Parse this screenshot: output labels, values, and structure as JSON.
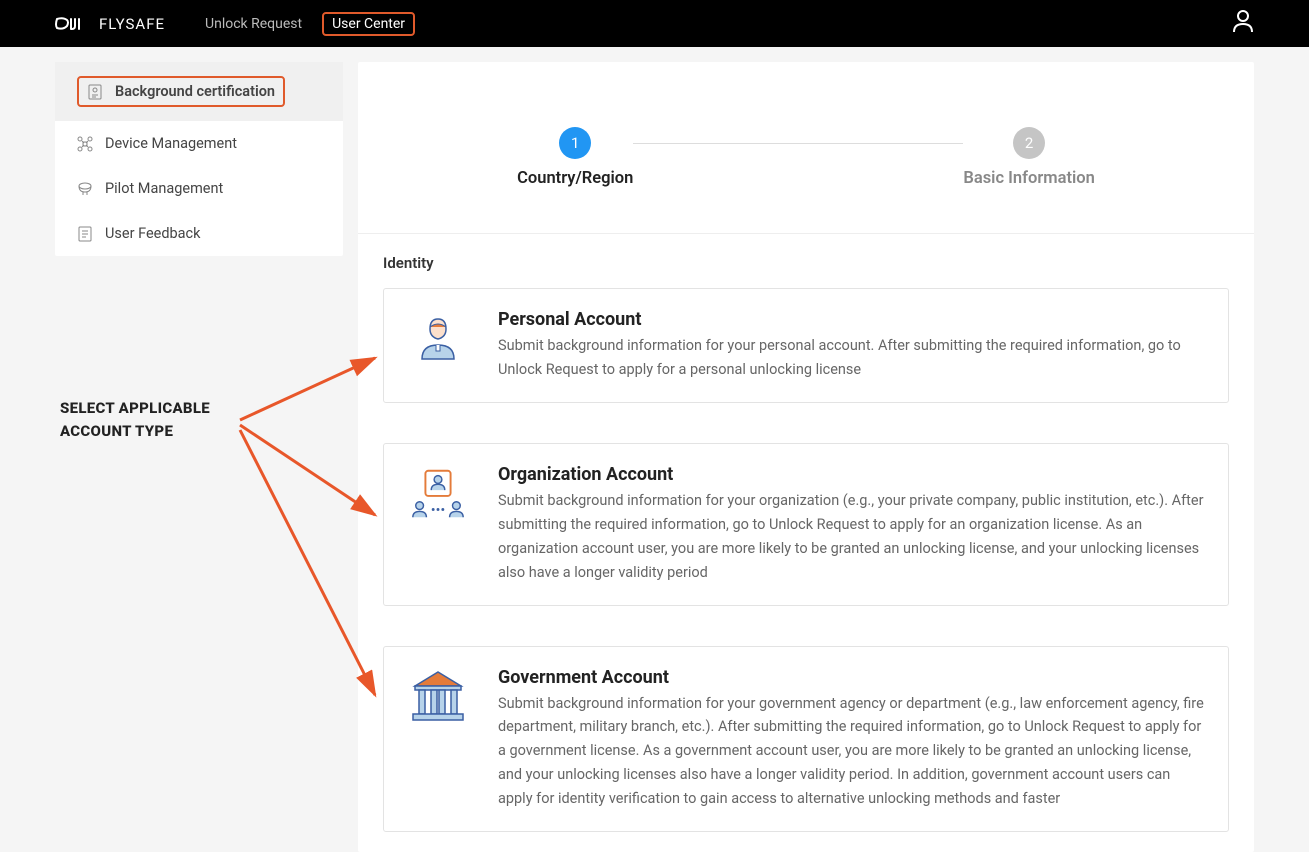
{
  "colors": {
    "highlight": "#e05a2b",
    "step_active": "#2196f3",
    "step_inactive": "#c5c5c5"
  },
  "header": {
    "brand_prefix": "dji",
    "brand_suffix": "FLYSAFE",
    "nav": {
      "unlock_request": "Unlock Request",
      "user_center": "User Center"
    }
  },
  "sidebar": {
    "items": [
      {
        "label": "Background certification",
        "icon": "certificate-icon",
        "active": true
      },
      {
        "label": "Device Management",
        "icon": "drone-icon",
        "active": false
      },
      {
        "label": "Pilot Management",
        "icon": "pilot-icon",
        "active": false
      },
      {
        "label": "User Feedback",
        "icon": "feedback-icon",
        "active": false
      }
    ]
  },
  "steps": {
    "step1": {
      "number": "1",
      "label": "Country/Region"
    },
    "step2": {
      "number": "2",
      "label": "Basic Information"
    }
  },
  "identity": {
    "heading": "Identity",
    "options": [
      {
        "title": "Personal Account",
        "desc": "Submit background information for your personal account. After submitting the required information, go to Unlock Request to apply for a personal unlocking license"
      },
      {
        "title": "Organization Account",
        "desc": "Submit background information for your organization (e.g., your private company, public institution, etc.). After submitting the required information, go to Unlock Request to apply for an organization license. As an organization account user, you are more likely to be granted an unlocking license, and your unlocking licenses also have a longer validity period"
      },
      {
        "title": "Government Account",
        "desc": "Submit background information for your government agency or department (e.g., law enforcement agency, fire department, military branch, etc.). After submitting the required information, go to Unlock Request to apply for a government license. As a government account user, you are more likely to be granted an unlocking license, and your unlocking licenses also have a longer validity period. In addition, government account users can apply for identity verification to gain access to alternative unlocking methods and faster"
      }
    ]
  },
  "annotation": {
    "line1": "SELECT APPLICABLE",
    "line2": "ACCOUNT TYPE"
  }
}
